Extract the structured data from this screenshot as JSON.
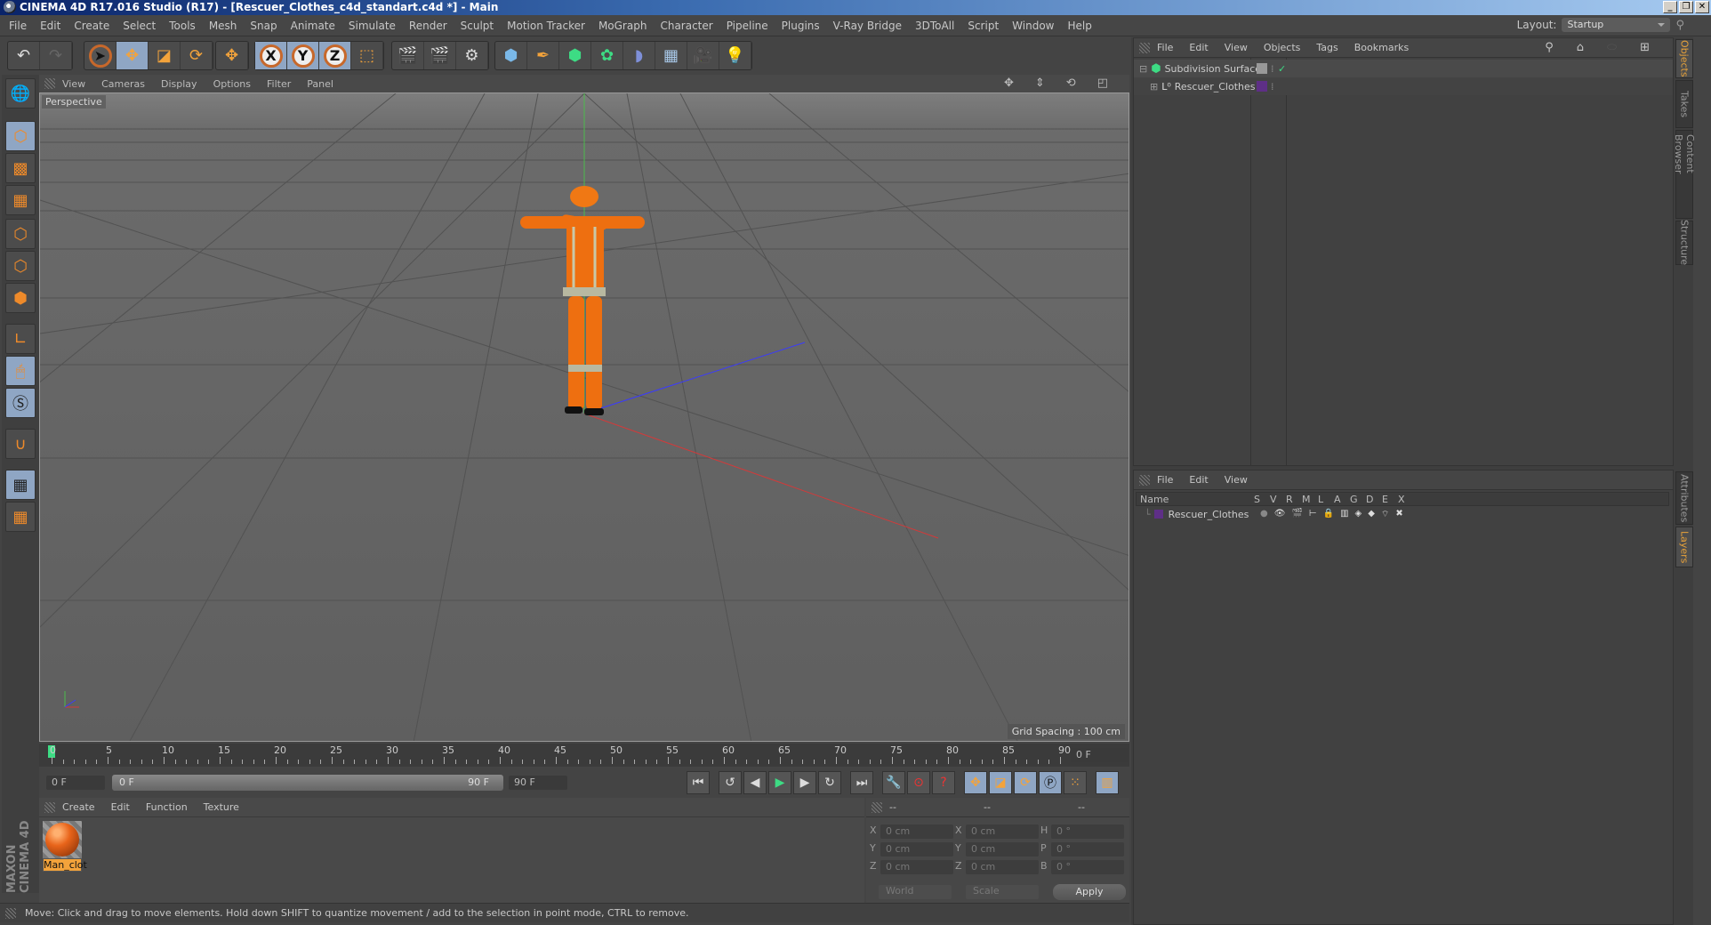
{
  "window": {
    "title": "CINEMA 4D R17.016 Studio (R17) - [Rescuer_Clothes_c4d_standart.c4d *] - Main",
    "controls": [
      "_",
      "❐",
      "✕"
    ]
  },
  "menubar": {
    "items": [
      "File",
      "Edit",
      "Create",
      "Select",
      "Tools",
      "Mesh",
      "Snap",
      "Animate",
      "Simulate",
      "Render",
      "Sculpt",
      "Motion Tracker",
      "MoGraph",
      "Character",
      "Pipeline",
      "Plugins",
      "V-Ray Bridge",
      "3DToAll",
      "Script",
      "Window",
      "Help"
    ],
    "layout_label": "Layout:",
    "layout_value": "Startup"
  },
  "toolbar": {
    "icons": [
      "undo-icon",
      "redo-icon",
      "live-selection-icon",
      "move-icon",
      "scale-icon",
      "rotate-icon",
      "recent-tool-icon",
      "x-axis-icon",
      "y-axis-icon",
      "z-axis-icon",
      "coordinate-system-icon",
      "render-view-icon",
      "render-picture-viewer-icon",
      "render-settings-icon",
      "cube-icon",
      "pen-icon",
      "subdivision-surface-icon",
      "cloner-icon",
      "deformer-icon",
      "floor-icon",
      "camera-icon",
      "light-icon"
    ],
    "axis_labels": [
      "X",
      "Y",
      "Z"
    ]
  },
  "left_tools": [
    "make-editable-icon",
    "model-mode-icon",
    "texture-mode-icon",
    "workplane-mode-icon",
    "points-mode-icon",
    "edges-mode-icon",
    "polygons-mode-icon",
    "axis-mode-icon",
    "tweak-mode-icon",
    "solo-icon",
    "snap-icon",
    "workplane-lock-icon",
    "workplane-align-icon"
  ],
  "viewport": {
    "menu": [
      "View",
      "Cameras",
      "Display",
      "Options",
      "Filter",
      "Panel"
    ],
    "label": "Perspective",
    "grid_spacing": "Grid Spacing : 100 cm"
  },
  "object_manager": {
    "menu": [
      "File",
      "Edit",
      "View",
      "Objects",
      "Tags",
      "Bookmarks"
    ],
    "objects": [
      {
        "name": "Subdivision Surface",
        "expanded": true,
        "check": "✓"
      },
      {
        "name": "Rescuer_Clothes",
        "expanded": false
      }
    ]
  },
  "layer_manager": {
    "menu": [
      "File",
      "Edit",
      "View"
    ],
    "columns": [
      "Name",
      "S",
      "V",
      "R",
      "M",
      "L",
      "A",
      "G",
      "D",
      "E",
      "X"
    ],
    "layers": [
      {
        "name": "Rescuer_Clothes",
        "color": "#5e2f86"
      }
    ]
  },
  "side_tabs_top": [
    "Objects",
    "Takes",
    "Content Browser",
    "Structure"
  ],
  "side_tabs_bottom": [
    "Attributes",
    "Layers"
  ],
  "timeline": {
    "ticks": [
      "0",
      "5",
      "10",
      "15",
      "20",
      "25",
      "30",
      "35",
      "40",
      "45",
      "50",
      "55",
      "60",
      "65",
      "70",
      "75",
      "80",
      "85",
      "90"
    ],
    "current_frame": "0 F",
    "start": "0 F",
    "range_start": "0 F",
    "range_end": "90 F",
    "end": "90 F"
  },
  "material_manager": {
    "menu": [
      "Create",
      "Edit",
      "Function",
      "Texture"
    ],
    "materials": [
      {
        "name": "Man_clot"
      }
    ]
  },
  "coordinates": {
    "headers": [
      "--",
      "--",
      "--"
    ],
    "pos": [
      {
        "axis": "X",
        "value": "0 cm"
      },
      {
        "axis": "Y",
        "value": "0 cm"
      },
      {
        "axis": "Z",
        "value": "0 cm"
      }
    ],
    "size": [
      {
        "axis": "X",
        "value": "0 cm"
      },
      {
        "axis": "Y",
        "value": "0 cm"
      },
      {
        "axis": "Z",
        "value": "0 cm"
      }
    ],
    "rot": [
      {
        "axis": "H",
        "value": "0 °"
      },
      {
        "axis": "P",
        "value": "0 °"
      },
      {
        "axis": "B",
        "value": "0 °"
      }
    ],
    "mode1": "World",
    "mode2": "Scale",
    "apply": "Apply"
  },
  "status": "Move: Click and drag to move elements. Hold down SHIFT to quantize movement / add to the selection in point mode, CTRL to remove.",
  "branding": "MAXON CINEMA 4D",
  "colors": {
    "accent": "#f3a33b",
    "active_btn": "#8fa6c4",
    "play": "#3ddc84",
    "layer": "#5e2f86"
  }
}
